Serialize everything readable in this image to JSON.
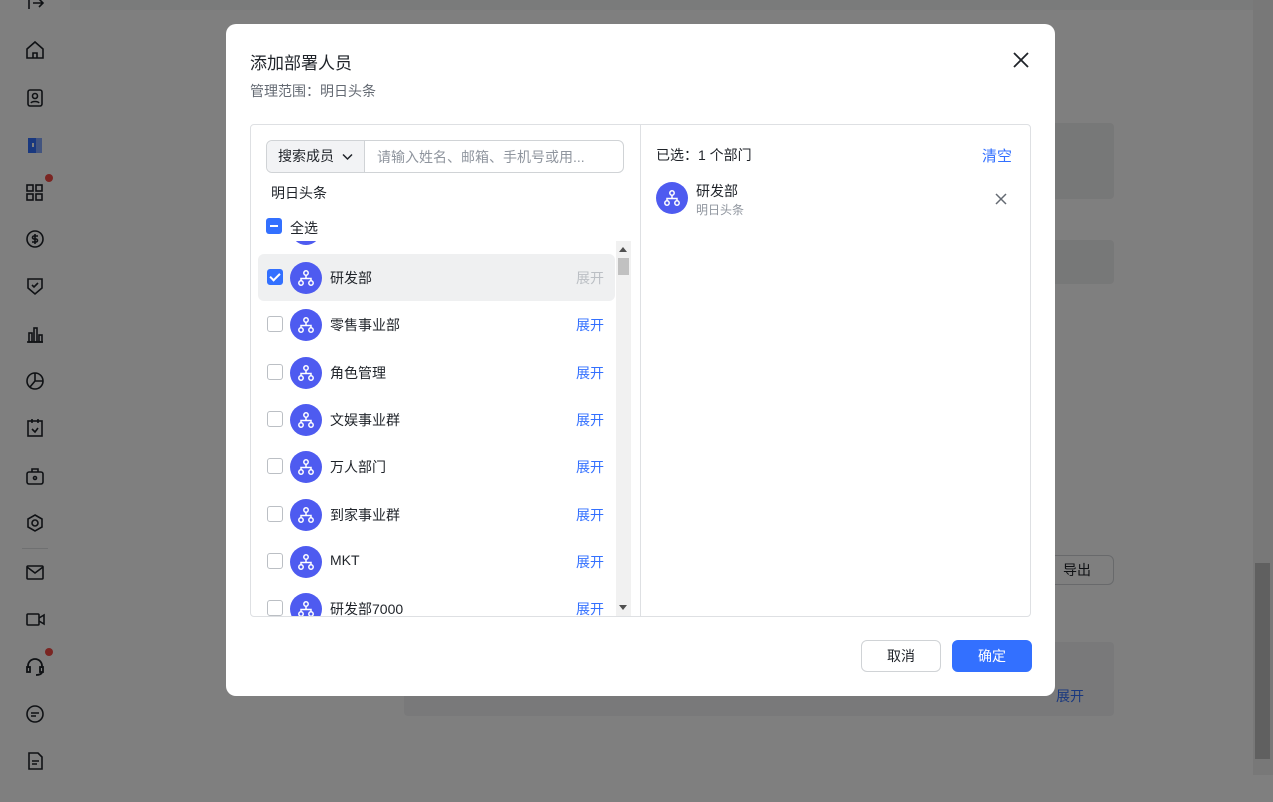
{
  "background": {
    "export_label": "导出",
    "expand_label": "展开",
    "sidebar_icons": [
      "logout-icon",
      "home-icon",
      "contacts-icon",
      "workplace-icon",
      "apps-icon",
      "billing-icon",
      "security-icon",
      "analytics-icon",
      "pie-chart-icon",
      "calendar-icon",
      "toolbox-icon",
      "settings-icon",
      "mail-icon",
      "video-icon",
      "support-icon",
      "chat-icon",
      "docs-icon"
    ]
  },
  "modal": {
    "title": "添加部署人员",
    "scope_label": "管理范围：明日头条",
    "search": {
      "type_label": "搜索成员",
      "placeholder": "请输入姓名、邮箱、手机号或用..."
    },
    "org_name": "明日头条",
    "select_all_label": "全选",
    "departments": [
      {
        "name": "研发部",
        "checked": true,
        "expand_label": "展开",
        "expand_enabled": false
      },
      {
        "name": "零售事业部",
        "checked": false,
        "expand_label": "展开",
        "expand_enabled": true
      },
      {
        "name": "角色管理",
        "checked": false,
        "expand_label": "展开",
        "expand_enabled": true
      },
      {
        "name": "文娱事业群",
        "checked": false,
        "expand_label": "展开",
        "expand_enabled": true
      },
      {
        "name": "万人部门",
        "checked": false,
        "expand_label": "展开",
        "expand_enabled": true
      },
      {
        "name": "到家事业群",
        "checked": false,
        "expand_label": "展开",
        "expand_enabled": true
      },
      {
        "name": "MKT",
        "checked": false,
        "expand_label": "展开",
        "expand_enabled": true
      },
      {
        "name": "研发部7000",
        "checked": false,
        "expand_label": "展开",
        "expand_enabled": true
      }
    ],
    "selected_summary": "已选：1 个部门",
    "clear_label": "清空",
    "selected_items": [
      {
        "name": "研发部",
        "org": "明日头条"
      }
    ],
    "cancel_label": "取消",
    "confirm_label": "确定"
  },
  "colors": {
    "accent": "#3370ff",
    "avatar": "#4e5bf0",
    "badge": "#f54a45"
  }
}
